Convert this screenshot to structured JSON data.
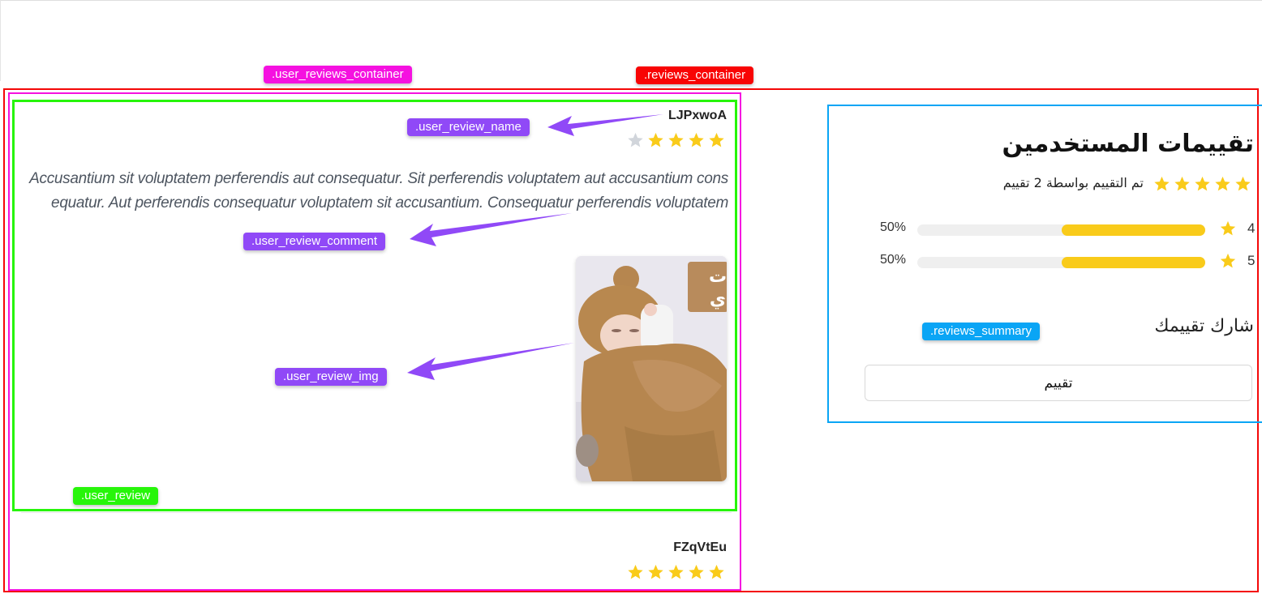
{
  "annotations": {
    "user_reviews_container": ".user_reviews_container",
    "reviews_container": ".reviews_container",
    "user_review_name": ".user_review_name",
    "user_review_comment": ".user_review_comment",
    "user_review_img": ".user_review_img",
    "reviews_summary": ".reviews_summary",
    "user_review": ".user_review"
  },
  "colors": {
    "star_filled": "#f9cb1a",
    "star_empty": "#d1d5db",
    "reviews_container_outline": "#f40707",
    "user_reviews_container_outline": "#f511e0",
    "user_review_outline": "#27f50a",
    "reviews_summary_outline": "#0aa5f5",
    "arrow": "#9049f7"
  },
  "reviews": [
    {
      "name": "LJPxwoA",
      "rating": 4,
      "max_rating": 5,
      "comment": "Accusantium sit voluptatem perferendis aut consequatur. Sit perferendis voluptatem aut accusantium consequatur. Aut perferendis consequatur voluptatem sit accusantium. Consequatur perferendis voluptatem",
      "image": "baby-in-brown-bear-swaddle-photo",
      "image_badge_text": "ت ي"
    },
    {
      "name": "FZqVtEu",
      "rating": 5,
      "max_rating": 5
    }
  ],
  "summary": {
    "title": "تقييمات المستخدمين",
    "average_rating": 5,
    "rated_by_text": "تم التقييم بواسطة 2 تقييم",
    "distribution": [
      {
        "stars": "4",
        "percent_label": "50%",
        "fraction": 0.5
      },
      {
        "stars": "5",
        "percent_label": "50%",
        "fraction": 0.5
      }
    ],
    "share_label": "شارك تقييمك",
    "rate_button_label": "تقييم"
  }
}
